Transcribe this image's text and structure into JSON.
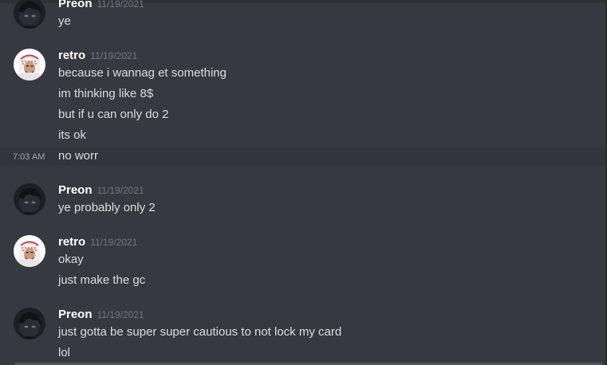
{
  "colors": {
    "background": "#36393f",
    "username_preon": "#ffffff",
    "username_retro": "#ffffff",
    "message_text": "#dcddde",
    "timestamp": "#72767d",
    "hover_row": "#32353b"
  },
  "messages": [
    {
      "author": "Preon",
      "date": "11/19/2021",
      "lines": [
        "ye"
      ]
    },
    {
      "author": "retro",
      "date": "11/19/2021",
      "lines": [
        "because i wannag et something",
        "im thinking like 8$",
        "but if u can only do 2",
        "its ok",
        "no worr"
      ],
      "hover_time": "7:03 AM"
    },
    {
      "author": "Preon",
      "date": "11/19/2021",
      "lines": [
        "ye probably only 2"
      ]
    },
    {
      "author": "retro",
      "date": "11/19/2021",
      "lines": [
        "okay",
        "just make the gc"
      ]
    },
    {
      "author": "Preon",
      "date": "11/19/2021",
      "lines": [
        "just gotta be super super cautious to not lock my card",
        "lol"
      ]
    }
  ]
}
